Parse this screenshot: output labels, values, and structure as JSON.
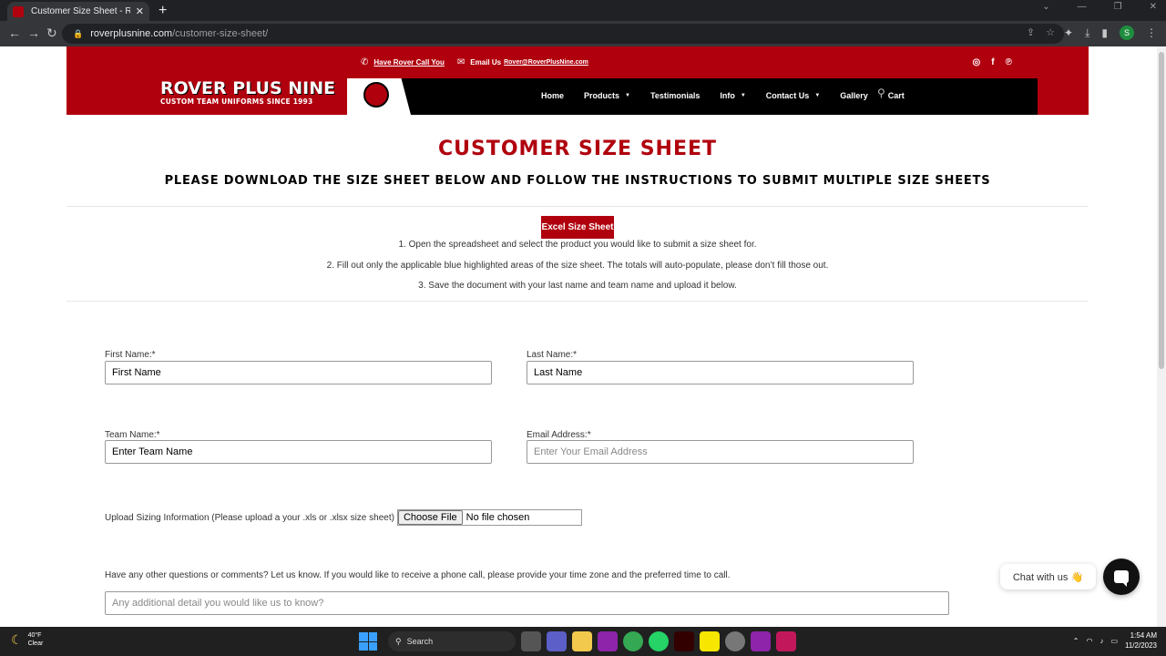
{
  "browser": {
    "tab_title": "Customer Size Sheet - Rover Pl",
    "new_tab_glyph": "+",
    "url_host": "roverplusnine.com",
    "url_path": "/customer-size-sheet/",
    "profile_initial": "S"
  },
  "site": {
    "call_link": "Have Rover Call You",
    "email_prefix": "Email Us",
    "email_link": "Rover@RoverPlusNine.com",
    "logo_title": "ROVER PLUS NINE",
    "logo_tagline": "CUSTOM TEAM UNIFORMS SINCE 1993",
    "nav": [
      "Home",
      "Products",
      "Testimonials",
      "Info",
      "Contact Us",
      "Gallery",
      "Cart"
    ],
    "social": [
      "instagram-icon",
      "facebook-icon",
      "pinterest-icon"
    ]
  },
  "content": {
    "title": "CUSTOMER SIZE SHEET",
    "subtitle": "PLEASE DOWNLOAD THE SIZE SHEET BELOW AND FOLLOW THE INSTRUCTIONS TO SUBMIT MULTIPLE SIZE SHEETS",
    "excel_button": "Excel Size Sheet",
    "steps": [
      "1. Open the spreadsheet and select the product you would like to submit a size sheet for.",
      "2. Fill out only the applicable blue highlighted areas of the size sheet. The totals will auto-populate, please don’t fill those out.",
      "3. Save the document with your last name and team name and upload it below."
    ]
  },
  "form": {
    "first_name_label": "First Name:*",
    "first_name_value": "First Name",
    "last_name_label": "Last Name:*",
    "last_name_value": "Last Name",
    "team_name_label": "Team Name:*",
    "team_name_value": "Enter Team Name",
    "email_label": "Email Address:*",
    "email_placeholder": "Enter Your Email Address",
    "upload_label": "Upload Sizing Information (Please upload a your .xls or .xlsx size sheet)",
    "file_button": "Choose File",
    "file_status": "No file chosen",
    "comments_label": "Have any other questions or comments? Let us know. If you would like to receive a phone call, please provide your time zone and the preferred time to call.",
    "comments_placeholder": "Any additional detail you would like us to know?"
  },
  "chat": {
    "bubble_text": "Chat with us 👋"
  },
  "taskbar": {
    "temp": "40°F",
    "condition": "Clear",
    "search": "Search",
    "time": "1:54 AM",
    "date": "11/2/2023"
  },
  "colors": {
    "brand_red": "#b0000e",
    "nav_black": "#000000"
  }
}
